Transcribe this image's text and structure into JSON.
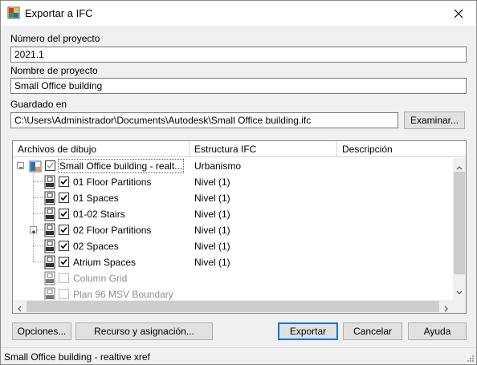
{
  "window": {
    "title": "Exportar a IFC",
    "status": "Small Office building - realtive xref"
  },
  "form": {
    "project_number_label": "Número del proyecto",
    "project_number_value": "2021.1",
    "project_name_label": "Nombre de proyecto",
    "project_name_value": "Small Office building",
    "saved_in_label": "Guardado en",
    "saved_in_value": "C:\\Users\\Administrador\\Documents\\Autodesk\\Small Office building.ifc",
    "browse_label": "Examinar..."
  },
  "grid": {
    "columns": [
      "Archivos de dibujo",
      "Estructura IFC",
      "Descripción"
    ],
    "rows": [
      {
        "name": "Small Office building - realt...",
        "structure": "Urbanismo",
        "checked": true,
        "enabled": true,
        "root": true
      },
      {
        "name": "01 Floor Partitions",
        "structure": "Nivel (1)",
        "checked": true,
        "enabled": true
      },
      {
        "name": "01 Spaces",
        "structure": "Nivel (1)",
        "checked": true,
        "enabled": true
      },
      {
        "name": "01-02 Stairs",
        "structure": "Nivel (1)",
        "checked": true,
        "enabled": true
      },
      {
        "name": "02 Floor Partitions",
        "structure": "Nivel (1)",
        "checked": true,
        "enabled": true,
        "expandable": true
      },
      {
        "name": "02 Spaces",
        "structure": "Nivel (1)",
        "checked": true,
        "enabled": true
      },
      {
        "name": "Atrium Spaces",
        "structure": "Nivel (1)",
        "checked": true,
        "enabled": true
      },
      {
        "name": "Column Grid",
        "structure": "",
        "checked": false,
        "enabled": false
      },
      {
        "name": "Plan 96 MSV Boundary",
        "structure": "",
        "checked": false,
        "enabled": false
      }
    ]
  },
  "buttons": {
    "options": "Opciones...",
    "resource": "Recurso y asignación...",
    "export": "Exportar",
    "cancel": "Cancelar",
    "help": "Ayuda"
  },
  "colors": {
    "accent": "#0078d7",
    "disabled_text": "#8c8c8c"
  }
}
